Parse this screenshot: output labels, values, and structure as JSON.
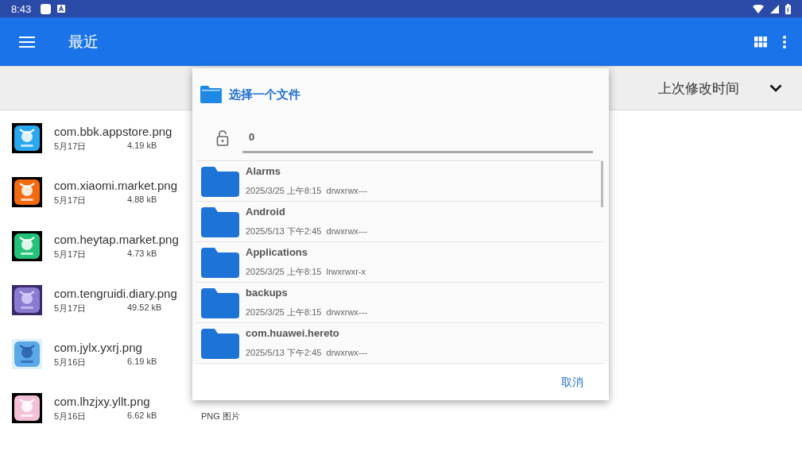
{
  "status_bar": {
    "time": "8:43"
  },
  "app_bar": {
    "title": "最近"
  },
  "sort_bar": {
    "label": "上次修改时间"
  },
  "files": [
    {
      "name": "com.bbk.appstore.png",
      "date": "5月17日",
      "size": "4.19 kB"
    },
    {
      "name": "com.xiaomi.market.png",
      "date": "5月17日",
      "size": "4.88 kB"
    },
    {
      "name": "com.heytap.market.png",
      "date": "5月17日",
      "size": "4.73 kB"
    },
    {
      "name": "com.tengruidi.diary.png",
      "date": "5月17日",
      "size": "49.52 kB"
    },
    {
      "name": "com.jylx.yxrj.png",
      "date": "5月16日",
      "size": "6.19 kB"
    },
    {
      "name": "com.lhzjxy.yllt.png",
      "date": "5月16日",
      "size": "6.62 kB",
      "type": "PNG 图片"
    }
  ],
  "dialog": {
    "title": "选择一个文件",
    "path": "0",
    "cancel": "取消",
    "folders": [
      {
        "name": "Alarms",
        "date": "2025/3/25 上午8:15",
        "perms": "drwxrwx---"
      },
      {
        "name": "Android",
        "date": "2025/5/13 下午2:45",
        "perms": "drwxrwx---"
      },
      {
        "name": "Applications",
        "date": "2025/3/25 上午8:15",
        "perms": "lrwxrwxr-x"
      },
      {
        "name": "backups",
        "date": "2025/3/25 上午8:15",
        "perms": "drwxrwx---"
      },
      {
        "name": "com.huawei.hereto",
        "date": "2025/5/13 下午2:45",
        "perms": "drwxrwx---"
      }
    ]
  }
}
